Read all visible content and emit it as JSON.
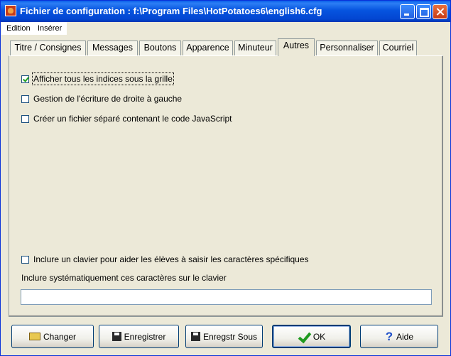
{
  "window": {
    "title": "Fichier de configuration : f:\\Program Files\\HotPotatoes6\\english6.cfg"
  },
  "menu": {
    "items": [
      {
        "label": "Edition"
      },
      {
        "label": "Insérer"
      }
    ]
  },
  "tabs": [
    {
      "label": "Titre / Consignes",
      "active": false
    },
    {
      "label": "Messages",
      "active": false
    },
    {
      "label": "Boutons",
      "active": false
    },
    {
      "label": "Apparence",
      "active": false
    },
    {
      "label": "Minuteur",
      "active": false
    },
    {
      "label": "Autres",
      "active": true
    },
    {
      "label": "Personnaliser",
      "active": false
    },
    {
      "label": "Courriel",
      "active": false
    }
  ],
  "options": [
    {
      "label": "Afficher tous les indices sous la grille",
      "checked": true
    },
    {
      "label": "Gestion de l'écriture de droite à gauche",
      "checked": false
    },
    {
      "label": "Créer un fichier séparé contenant le code JavaScript",
      "checked": false
    }
  ],
  "keyboard": {
    "include_label": "Inclure un clavier pour aider les élèves à saisir les caractères spécifiques",
    "include_checked": false,
    "chars_label": "Inclure systématiquement ces caractères sur le clavier",
    "chars_value": ""
  },
  "buttons": {
    "change": "Changer",
    "save": "Enregistrer",
    "save_as": "Enregstr Sous",
    "ok": "OK",
    "help": "Aide"
  },
  "icons": {
    "app": "hotpotatoes-icon",
    "change": "folder-open-icon",
    "save": "floppy-disk-icon",
    "save_as": "floppy-disk-save-as-icon",
    "ok": "green-check-icon",
    "help": "question-mark-icon"
  }
}
